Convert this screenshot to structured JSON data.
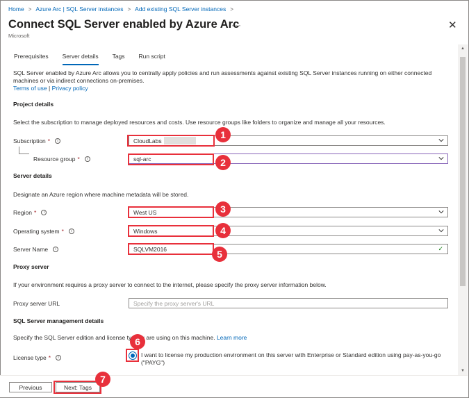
{
  "breadcrumb": [
    "Home",
    "Azure Arc | SQL Server instances",
    "Add existing SQL Server instances"
  ],
  "header": {
    "title": "Connect SQL Server enabled by Azure Arc",
    "more": "···",
    "publisher": "Microsoft",
    "close": "✕"
  },
  "tabs": [
    {
      "label": "Prerequisites",
      "active": false
    },
    {
      "label": "Server details",
      "active": true
    },
    {
      "label": "Tags",
      "active": false
    },
    {
      "label": "Run script",
      "active": false
    }
  ],
  "intro": {
    "text": "SQL Server enabled by Azure Arc allows you to centrally apply policies and run assessments against existing SQL Server instances running on either connected machines or via indirect connections on-premises.",
    "terms": "Terms of use",
    "divider": "|",
    "privacy": "Privacy policy"
  },
  "project": {
    "heading": "Project details",
    "desc": "Select the subscription to manage deployed resources and costs. Use resource groups like folders to organize and manage all your resources.",
    "subscription_label": "Subscription",
    "subscription_value": "CloudLabs",
    "resource_group_label": "Resource group",
    "resource_group_value": "sql-arc"
  },
  "server": {
    "heading": "Server details",
    "desc": "Designate an Azure region where machine metadata will be stored.",
    "region_label": "Region",
    "region_value": "West US",
    "os_label": "Operating system",
    "os_value": "Windows",
    "name_label": "Server Name",
    "name_value": "SQLVM2016"
  },
  "proxy": {
    "heading": "Proxy server",
    "desc": "If your environment requires a proxy server to connect to the internet, please specify the proxy server information below.",
    "url_label": "Proxy server URL",
    "url_placeholder": "Specify the proxy server's URL"
  },
  "management": {
    "heading": "SQL Server management details",
    "desc_part1": "Specify the SQL Server edition and license ty",
    "desc_part2": "u are using on this machine.",
    "learn_more": "Learn more",
    "license_label": "License type",
    "license_option": "I want to license my production environment on this server with Enterprise or Standard edition using pay-as-you-go (\"PAYG\")"
  },
  "footer": {
    "previous": "Previous",
    "next": "Next: Tags"
  },
  "markers": [
    "1",
    "2",
    "3",
    "4",
    "5",
    "6",
    "7"
  ],
  "colors": {
    "accent": "#0067b8",
    "marker": "#e8303b",
    "required": "#a4262c"
  }
}
